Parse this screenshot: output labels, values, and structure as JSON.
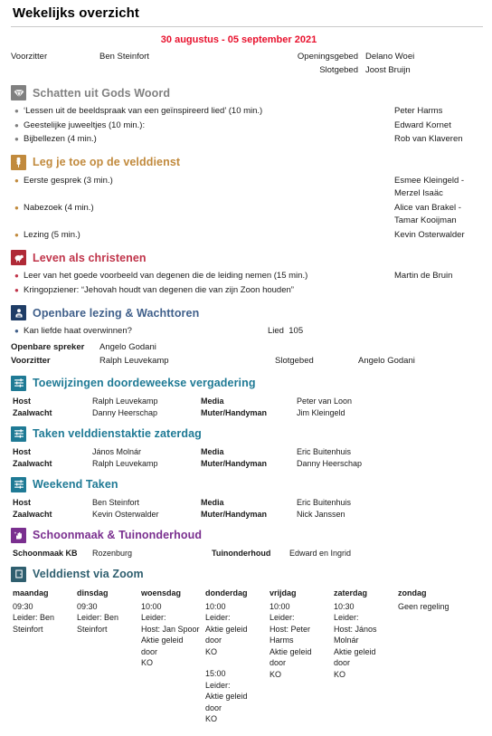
{
  "document": {
    "title": "Wekelijks overzicht",
    "date_range": "30 augustus - 05 september 2021"
  },
  "colors": {
    "date": "#e8112d",
    "treasures": "#808080",
    "ministry": "#c18a3d",
    "living": "#c0344a",
    "public_talk": "#3f5f8a",
    "assignments": "#1f7a95",
    "cleaning": "#7a2f8f",
    "zoom": "#2f5f6f"
  },
  "header": {
    "chairman_label": "Voorzitter",
    "chairman_name": "Ben Steinfort",
    "opening_prayer_label": "Openingsgebed",
    "opening_prayer_name": "Delano Woei",
    "closing_prayer_label": "Slotgebed",
    "closing_prayer_name": "Joost Bruijn"
  },
  "sections": {
    "treasures": {
      "icon": "gem-icon",
      "title": "Schatten uit Gods Woord",
      "items": [
        {
          "text": "‘Lessen uit de beeldspraak van een geïnspireerd lied’ (10 min.)",
          "who": "Peter Harms"
        },
        {
          "text": "Geestelijke juweeltjes (10 min.):",
          "who": "Edward Kornet"
        },
        {
          "text": "Bijbellezen (4 min.)",
          "who": "Rob van Klaveren"
        }
      ]
    },
    "ministry": {
      "icon": "wheat-icon",
      "title": "Leg je toe op de velddienst",
      "items": [
        {
          "text": "Eerste gesprek (3 min.)",
          "who": "Esmee Kleingeld - Merzel Isaäc"
        },
        {
          "text": "Nabezoek (4 min.)",
          "who": "Alice van Brakel - Tamar Kooijman"
        },
        {
          "text": "Lezing (5 min.)",
          "who": "Kevin Osterwalder"
        }
      ]
    },
    "living": {
      "icon": "sheep-icon",
      "title": "Leven als christenen",
      "items": [
        {
          "text": "Leer van het goede voorbeeld van degenen die de leiding nemen (15 min.)",
          "who": "Martin de Bruin"
        },
        {
          "text": "Kringopziener: “Jehovah houdt van degenen die van zijn Zoon houden”",
          "who": ""
        }
      ]
    },
    "public_talk": {
      "icon": "speaker-podium-icon",
      "title": "Openbare lezing & Wachttoren",
      "talk_title": "Kan liefde haat overwinnen?",
      "song_label": "Lied",
      "song_number": "105",
      "speaker_label": "Openbare spreker",
      "speaker_name": "Angelo Godani",
      "chairman_label": "Voorzitter",
      "chairman_name": "Ralph Leuvekamp",
      "closing_prayer_label": "Slotgebed",
      "closing_prayer_name": "Angelo Godani"
    },
    "midweek_tasks": {
      "icon": "sliders-icon",
      "title": "Toewijzingen doordeweekse vergadering",
      "rows": [
        {
          "label1": "Host",
          "value1": "Ralph Leuvekamp",
          "label2": "Media",
          "value2": "Peter van Loon"
        },
        {
          "label1": "Zaalwacht",
          "value1": "Danny Heerschap",
          "label2": "Muter/Handyman",
          "value2": "Jim Kleingeld"
        }
      ]
    },
    "saturday_tasks": {
      "icon": "sliders-icon",
      "title": "Taken velddienstaktie zaterdag",
      "rows": [
        {
          "label1": "Host",
          "value1": "János Molnár",
          "label2": "Media",
          "value2": "Eric Buitenhuis"
        },
        {
          "label1": "Zaalwacht",
          "value1": "Ralph Leuvekamp",
          "label2": "Muter/Handyman",
          "value2": "Danny Heerschap"
        }
      ]
    },
    "weekend_tasks": {
      "icon": "sliders-icon",
      "title": "Weekend Taken",
      "rows": [
        {
          "label1": "Host",
          "value1": "Ben Steinfort",
          "label2": "Media",
          "value2": "Eric Buitenhuis"
        },
        {
          "label1": "Zaalwacht",
          "value1": "Kevin Osterwalder",
          "label2": "Muter/Handyman",
          "value2": "Nick Janssen"
        }
      ]
    },
    "cleaning": {
      "icon": "hand-sparkle-icon",
      "title": "Schoonmaak & Tuinonderhoud",
      "rows": [
        {
          "label1": "Schoonmaak KB",
          "value1": "Rozenburg",
          "label2": "Tuinonderhoud",
          "value2": "Edward en Ingrid"
        }
      ]
    },
    "zoom_service": {
      "icon": "door-icon",
      "title": "Velddienst via Zoom",
      "days": [
        {
          "day": "maandag",
          "blocks": [
            {
              "lines": [
                "09:30",
                "Leider: Ben",
                "Steinfort"
              ]
            }
          ]
        },
        {
          "day": "dinsdag",
          "blocks": [
            {
              "lines": [
                "09:30",
                "Leider: Ben",
                "Steinfort"
              ]
            }
          ]
        },
        {
          "day": "woensdag",
          "blocks": [
            {
              "lines": [
                "10:00",
                "Leider:",
                "Host: Jan Spoor",
                "Aktie geleid door",
                "KO"
              ]
            }
          ]
        },
        {
          "day": "donderdag",
          "blocks": [
            {
              "lines": [
                "10:00",
                "Leider:",
                "Aktie geleid door",
                "KO"
              ]
            },
            {
              "lines": [
                "15:00",
                "Leider:",
                "Aktie geleid door",
                "KO"
              ]
            }
          ]
        },
        {
          "day": "vrijdag",
          "blocks": [
            {
              "lines": [
                "10:00",
                "Leider:",
                "Host: Peter Harms",
                "Aktie geleid door",
                "KO"
              ]
            }
          ]
        },
        {
          "day": "zaterdag",
          "blocks": [
            {
              "lines": [
                "10:30",
                "Leider:",
                "Host: János",
                "Molnár",
                "Aktie geleid door",
                "KO"
              ]
            }
          ]
        },
        {
          "day": "zondag",
          "blocks": [
            {
              "lines": [
                "Geen regeling"
              ]
            }
          ]
        }
      ]
    }
  }
}
